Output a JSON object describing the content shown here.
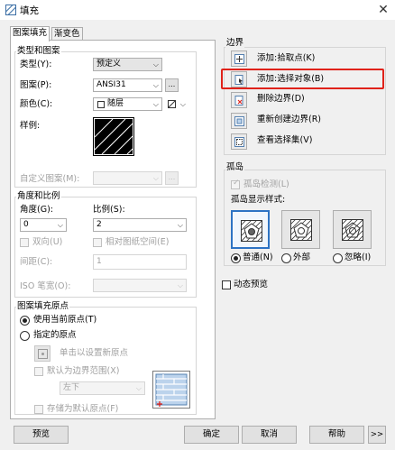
{
  "window": {
    "title": "填充",
    "close_glyph": "✕"
  },
  "tabs": [
    "图案填充",
    "渐变色"
  ],
  "type_pattern": {
    "group_title": "类型和图案",
    "type_label": "类型(Y):",
    "type_value": "预定义",
    "pattern_label": "图案(P):",
    "pattern_value": "ANSI31",
    "pattern_browse": "...",
    "color_label": "颜色(C):",
    "color_value": "随层",
    "swatch_label": "样例:",
    "custom_label": "自定义图案(M):",
    "custom_browse": "..."
  },
  "angle_scale": {
    "group_title": "角度和比例",
    "angle_label": "角度(G):",
    "angle_value": "0",
    "scale_label": "比例(S):",
    "scale_value": "2",
    "double_label": "双向(U)",
    "relative_label": "相对图纸空间(E)",
    "spacing_label": "间距(C):",
    "spacing_value": "1",
    "iso_label": "ISO 笔宽(O):"
  },
  "origin": {
    "group_title": "图案填充原点",
    "current_label": "使用当前原点(T)",
    "specified_label": "指定的原点",
    "click_label": "单击以设置新原点",
    "default_label": "默认为边界范围(X)",
    "position_value": "左下",
    "store_label": "存储为默认原点(F)"
  },
  "boundary": {
    "group_title": "边界",
    "items": [
      "添加:拾取点(K)",
      "添加:选择对象(B)",
      "删除边界(D)",
      "重新创建边界(R)",
      "查看选择集(V)"
    ]
  },
  "islands": {
    "group_title": "孤岛",
    "detect_label": "孤岛检测(L)",
    "style_label": "孤岛显示样式:",
    "normal_label": "普通(N)",
    "outer_label": "外部",
    "ignore_label": "忽略(I)"
  },
  "preview_check": "动态预览",
  "buttons": {
    "preview": "预览",
    "ok": "确定",
    "cancel": "取消",
    "help": "帮助",
    "more": ">>"
  },
  "colors": {
    "highlight": "#e0221a",
    "selected_border": "#2d73c4",
    "hatch_bg": "#000000"
  }
}
